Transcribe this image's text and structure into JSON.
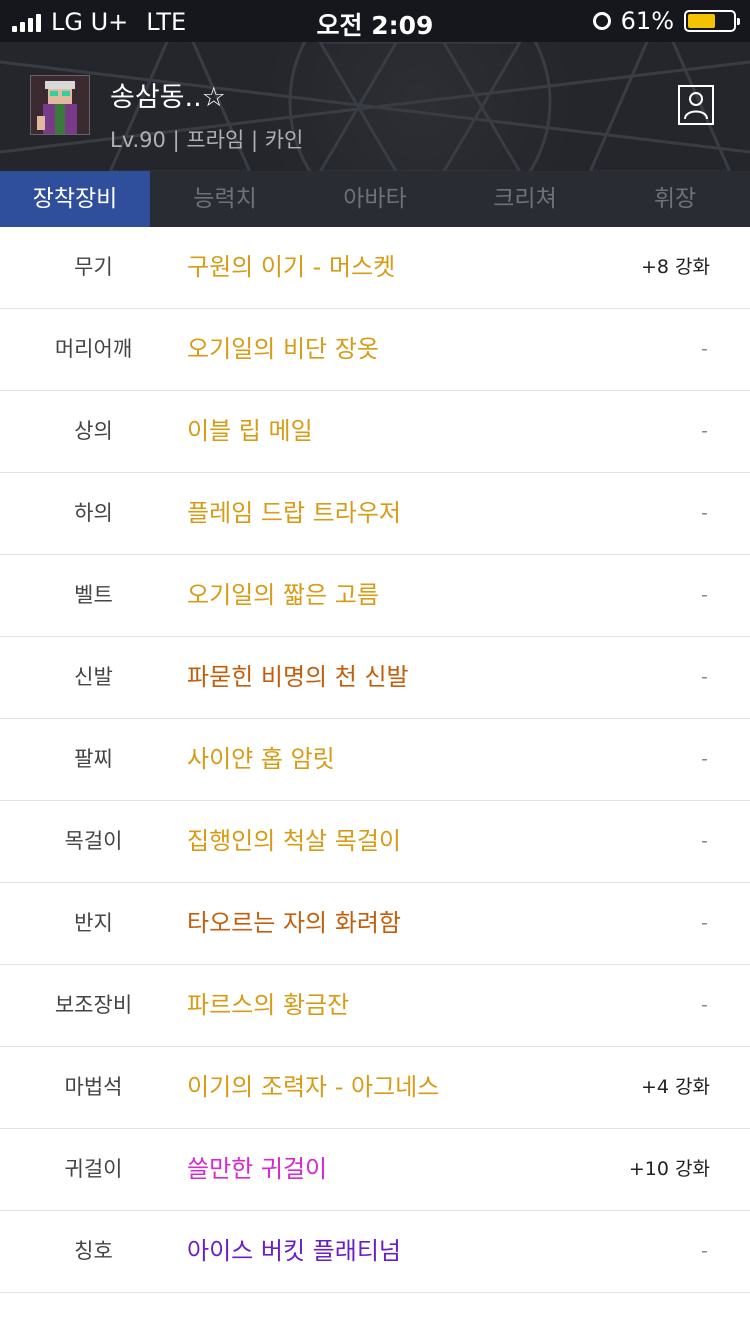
{
  "status_bar": {
    "carrier": "LG U+",
    "network": "LTE",
    "time": "오전 2:09",
    "battery": "61%",
    "battery_level": 0.61,
    "battery_color": "#f5c400"
  },
  "profile": {
    "name": "송삼동..☆",
    "info": "Lv.90 | 프라임 | 카인"
  },
  "tabs": [
    {
      "label": "장착장비",
      "active": true
    },
    {
      "label": "능력치",
      "active": false
    },
    {
      "label": "아바타",
      "active": false
    },
    {
      "label": "크리쳐",
      "active": false
    },
    {
      "label": "휘장",
      "active": false
    }
  ],
  "colors": {
    "epic": "#d79b16",
    "legendary": "#c35f0c",
    "rare": "#d62ad0",
    "unique": "#6a1fc5",
    "active_tab": "#2f4e9c"
  },
  "equipment": [
    {
      "slot": "무기",
      "item": "구원의 이기 - 머스켓",
      "enhance": "+8 강화",
      "color": "#d79b16"
    },
    {
      "slot": "머리어깨",
      "item": "오기일의 비단 장옷",
      "enhance": "-",
      "color": "#d79b16"
    },
    {
      "slot": "상의",
      "item": "이블 립 메일",
      "enhance": "-",
      "color": "#d79b16"
    },
    {
      "slot": "하의",
      "item": "플레임 드랍 트라우저",
      "enhance": "-",
      "color": "#d79b16"
    },
    {
      "slot": "벨트",
      "item": "오기일의 짧은 고름",
      "enhance": "-",
      "color": "#d79b16"
    },
    {
      "slot": "신발",
      "item": "파묻힌 비명의 천 신발",
      "enhance": "-",
      "color": "#c35f0c"
    },
    {
      "slot": "팔찌",
      "item": "사이얀 홉 암릿",
      "enhance": "-",
      "color": "#d79b16"
    },
    {
      "slot": "목걸이",
      "item": "집행인의 척살 목걸이",
      "enhance": "-",
      "color": "#d79b16"
    },
    {
      "slot": "반지",
      "item": "타오르는 자의 화려함",
      "enhance": "-",
      "color": "#c35f0c"
    },
    {
      "slot": "보조장비",
      "item": "파르스의 황금잔",
      "enhance": "-",
      "color": "#d79b16"
    },
    {
      "slot": "마법석",
      "item": "이기의 조력자 - 아그네스",
      "enhance": "+4 강화",
      "color": "#d79b16"
    },
    {
      "slot": "귀걸이",
      "item": "쓸만한 귀걸이",
      "enhance": "+10 강화",
      "color": "#d62ad0"
    },
    {
      "slot": "칭호",
      "item": "아이스 버킷 플래티넘",
      "enhance": "-",
      "color": "#6a1fc5"
    }
  ]
}
